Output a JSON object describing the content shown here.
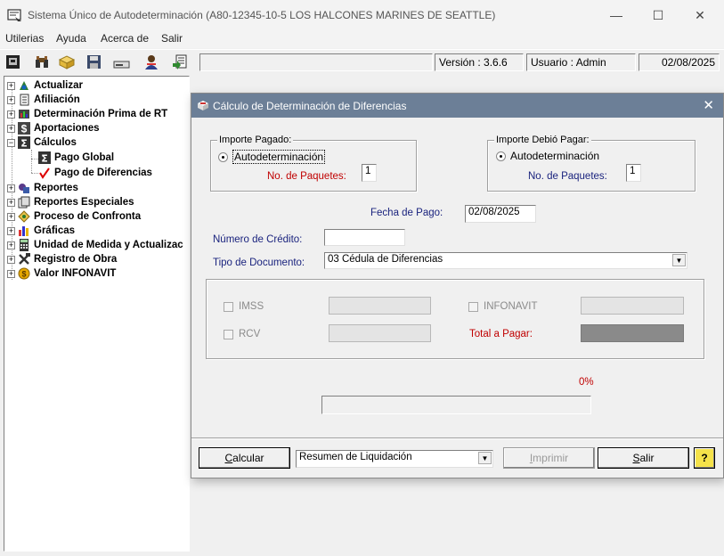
{
  "window": {
    "title": "Sistema Único de Autodeterminación (A80-12345-10-5  LOS HALCONES MARINES DE SEATTLE)",
    "minimize": "—",
    "maximize": "☐",
    "close": "✕"
  },
  "menu": [
    "Utilerias",
    "Ayuda",
    "Acerca de",
    "Salir"
  ],
  "toolbar": {
    "icons": [
      "printer-icon",
      "binoculars-icon",
      "folder-icon",
      "save-icon",
      "drive-icon",
      "person-icon",
      "export-icon"
    ],
    "version": "Versión : 3.6.6",
    "user": "Usuario : Admin",
    "date": "02/08/2025"
  },
  "tree": {
    "items": [
      {
        "label": "Actualizar",
        "icon": "update-icon",
        "expander": "+"
      },
      {
        "label": "Afiliación",
        "icon": "document-icon",
        "expander": "+"
      },
      {
        "label": "Determinación Prima de RT",
        "icon": "chart-icon",
        "expander": "+"
      },
      {
        "label": "Aportaciones",
        "icon": "dollar-icon",
        "expander": "+"
      },
      {
        "label": "Cálculos",
        "icon": "sigma-icon",
        "expander": "−"
      },
      {
        "label": "Pago Global",
        "icon": "sigma-icon"
      },
      {
        "label": "Pago de Diferencias",
        "icon": "checkmark-icon"
      },
      {
        "label": "Reportes",
        "icon": "reports-icon",
        "expander": "+"
      },
      {
        "label": "Reportes Especiales",
        "icon": "special-reports-icon",
        "expander": "+"
      },
      {
        "label": "Proceso de Confronta",
        "icon": "confronta-icon",
        "expander": "+"
      },
      {
        "label": "Gráficas",
        "icon": "bar-chart-icon",
        "expander": "+"
      },
      {
        "label": "Unidad de Medida y Actualizac",
        "icon": "calculator-icon",
        "expander": "+"
      },
      {
        "label": "Registro de Obra",
        "icon": "tools-icon",
        "expander": "+"
      },
      {
        "label": "Valor INFONAVIT",
        "icon": "coin-icon",
        "expander": "+"
      }
    ]
  },
  "dialog": {
    "title": "Cálculo de Determinación de Diferencias",
    "close": "✕",
    "importe_pagado": {
      "legend": "Importe Pagado:",
      "radio_label": "Autodeterminación",
      "paquetes_label": "No. de Paquetes:",
      "paquetes_value": "1"
    },
    "importe_debio": {
      "legend": "Importe Debió Pagar:",
      "radio_label": "Autodeterminación",
      "paquetes_label": "No. de Paquetes:",
      "paquetes_value": "1"
    },
    "fecha_pago_label": "Fecha de Pago:",
    "fecha_pago_value": "02/08/2025",
    "numero_credito_label": "Número de Crédito:",
    "numero_credito_value": "",
    "tipo_documento_label": "Tipo de Documento:",
    "tipo_documento_value": "03 Cédula de Diferencias",
    "imss_label": "IMSS",
    "rcv_label": "RCV",
    "infonavit_label": "INFONAVIT",
    "total_label": "Total a Pagar:",
    "progress_text": "0%",
    "progress_value": 0,
    "buttons": {
      "calcular": "Calcular",
      "calcular_hotkey": "C",
      "calcular_rest": "alcular",
      "report_select": "Resumen de Liquidación",
      "imprimir_hotkey": "I",
      "imprimir_rest": "mprimir",
      "salir_hotkey": "S",
      "salir_rest": "alir",
      "help": "?"
    }
  }
}
